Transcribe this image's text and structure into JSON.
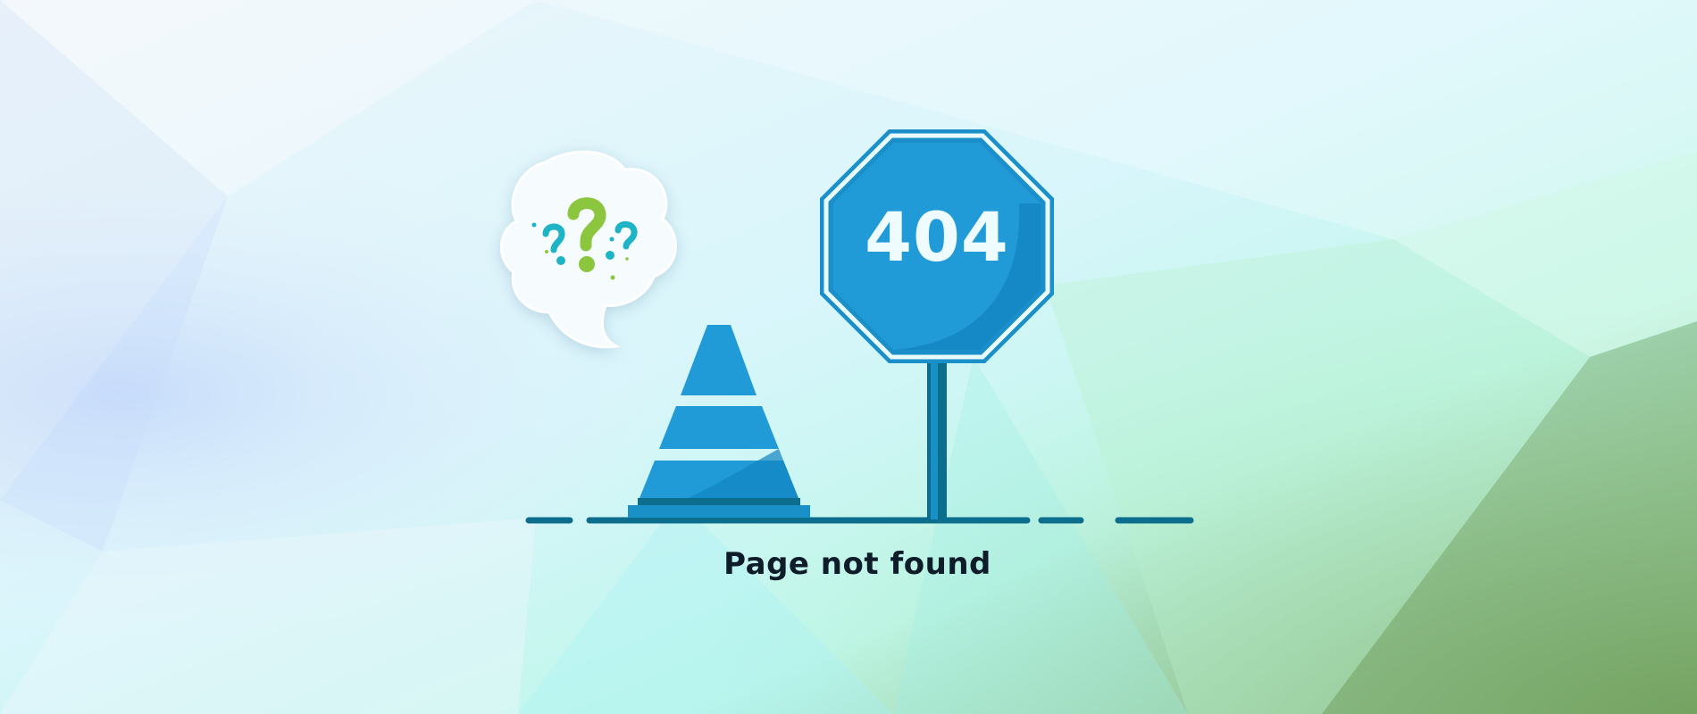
{
  "sign": {
    "code": "404"
  },
  "message": {
    "text": "Page not found"
  },
  "colors": {
    "sign_blue": "#219bd8",
    "sign_dark": "#1185c1",
    "ground": "#0d6d8c",
    "question_green": "#8cc63f",
    "question_teal": "#1fb3c6",
    "text": "#0f1c2a"
  },
  "icons": {
    "thought_bubble": "thought-bubble-icon",
    "traffic_cone": "traffic-cone-icon",
    "stop_sign": "stop-sign-icon"
  }
}
